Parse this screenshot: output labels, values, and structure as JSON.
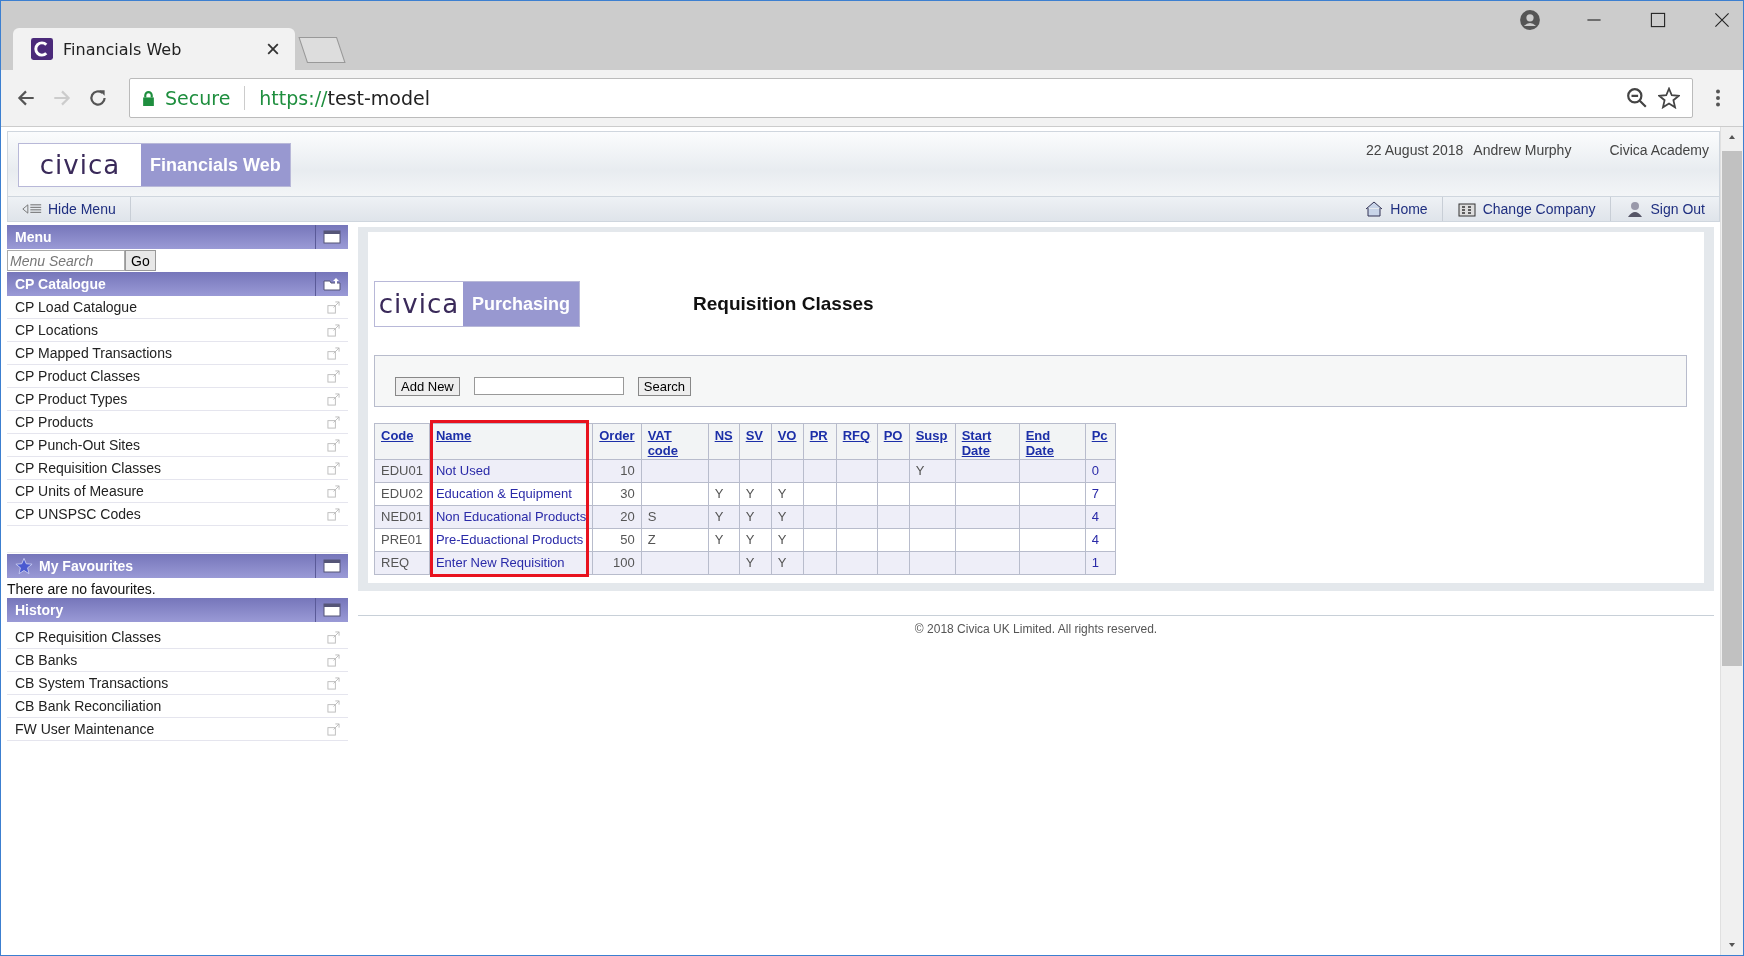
{
  "browser": {
    "tab_title": "Financials Web",
    "secure_label": "Secure",
    "url_scheme": "https://",
    "url_host": "test-model"
  },
  "header": {
    "logo_text": "civica",
    "product": "Financials Web",
    "date": "22 August 2018",
    "user": "Andrew Murphy",
    "company": "Civica Academy"
  },
  "nav": {
    "hide_menu": "Hide Menu",
    "links": [
      "Home",
      "Change Company",
      "Sign Out"
    ]
  },
  "sidebar": {
    "menu_title": "Menu",
    "search_placeholder": "Menu Search",
    "go": "Go",
    "catalogue": {
      "title": "CP Catalogue",
      "items": [
        "CP Load Catalogue",
        "CP Locations",
        "CP Mapped Transactions",
        "CP Product Classes",
        "CP Product Types",
        "CP Products",
        "CP Punch-Out Sites",
        "CP Requisition Classes",
        "CP Units of Measure",
        "CP UNSPSC Codes"
      ]
    },
    "favourites": {
      "title": "My Favourites",
      "empty_text": "There are no favourites."
    },
    "history": {
      "title": "History",
      "items": [
        "CP Requisition Classes",
        "CB Banks",
        "CB System Transactions",
        "CB Bank Reconciliation",
        "FW User Maintenance"
      ]
    }
  },
  "content": {
    "logo_text": "civica",
    "module": "Purchasing",
    "title": "Requisition Classes",
    "add_new": "Add New",
    "search": "Search",
    "table": {
      "columns": [
        {
          "label": "Code",
          "kind": "text",
          "highlighted": false
        },
        {
          "label": "Name",
          "kind": "link",
          "highlighted": true
        },
        {
          "label": "Order",
          "kind": "number",
          "highlighted": false
        },
        {
          "label": "VAT code",
          "kind": "text",
          "highlighted": false
        },
        {
          "label": "NS",
          "kind": "text",
          "highlighted": false
        },
        {
          "label": "SV",
          "kind": "text",
          "highlighted": false
        },
        {
          "label": "VO",
          "kind": "text",
          "highlighted": false
        },
        {
          "label": "PR",
          "kind": "text",
          "highlighted": false
        },
        {
          "label": "RFQ",
          "kind": "text",
          "highlighted": false
        },
        {
          "label": "PO",
          "kind": "text",
          "highlighted": false
        },
        {
          "label": "Susp",
          "kind": "text",
          "highlighted": false
        },
        {
          "label": "Start Date",
          "kind": "text",
          "highlighted": false
        },
        {
          "label": "End Date",
          "kind": "text",
          "highlighted": false
        },
        {
          "label": "Pc",
          "kind": "link",
          "highlighted": false
        }
      ],
      "rows": [
        [
          "EDU01",
          "Not Used",
          "10",
          "",
          "",
          "",
          "",
          "",
          "",
          "",
          "Y",
          "",
          "",
          "0"
        ],
        [
          "EDU02",
          "Education & Equipment",
          "30",
          "",
          "Y",
          "Y",
          "Y",
          "",
          "",
          "",
          "",
          "",
          "",
          "7"
        ],
        [
          "NED01",
          "Non Educational Products",
          "20",
          "S",
          "Y",
          "Y",
          "Y",
          "",
          "",
          "",
          "",
          "",
          "",
          "4"
        ],
        [
          "PRE01",
          "Pre-Eduactional Products",
          "50",
          "Z",
          "Y",
          "Y",
          "Y",
          "",
          "",
          "",
          "",
          "",
          "",
          "4"
        ],
        [
          "REQ",
          "Enter New Requisition",
          "100",
          "",
          "",
          "Y",
          "Y",
          "",
          "",
          "",
          "",
          "",
          "",
          "1"
        ]
      ]
    }
  },
  "footer": "© 2018 Civica UK Limited. All rights reserved."
}
